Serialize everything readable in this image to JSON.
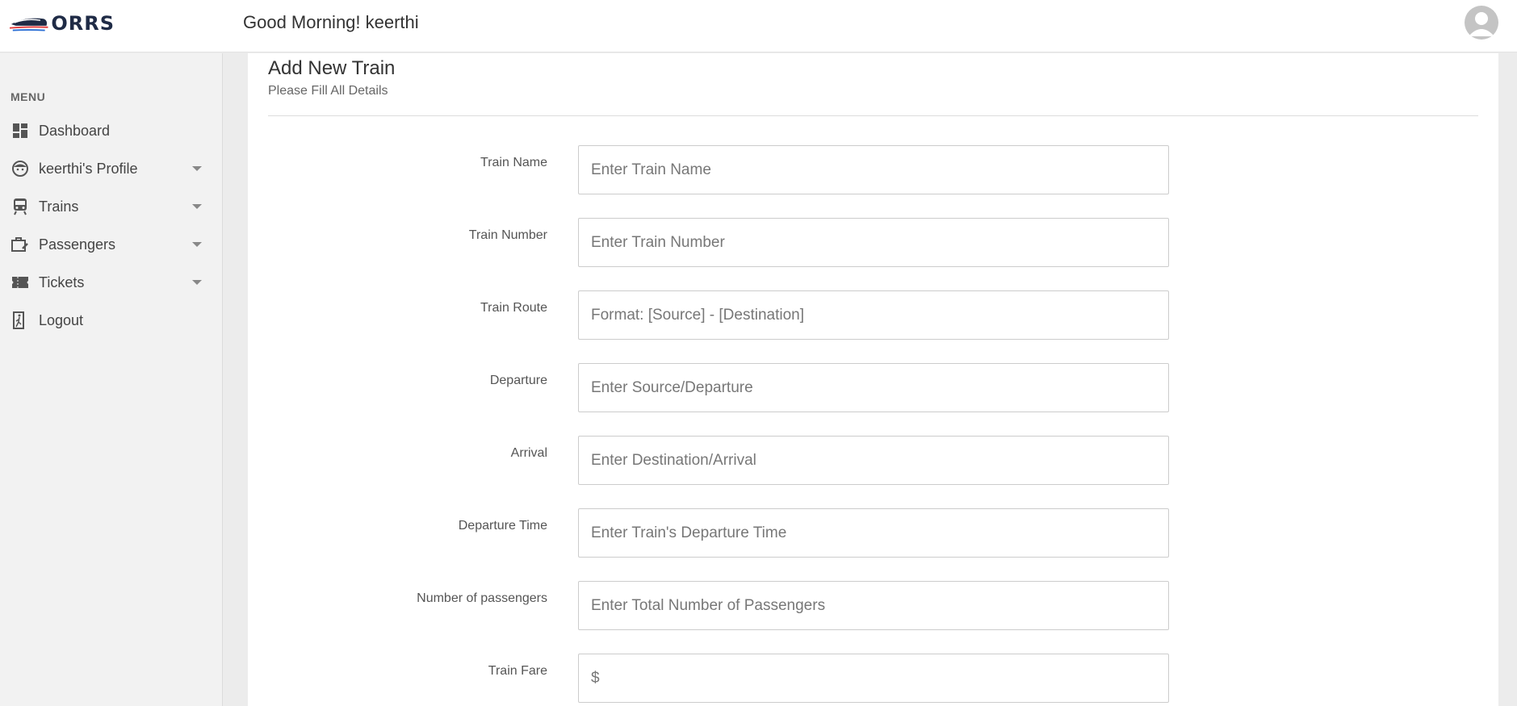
{
  "header": {
    "logo_text": "ORRS",
    "greeting": "Good Morning! keerthi"
  },
  "sidebar": {
    "menu_heading": "MENU",
    "items": [
      {
        "label": "Dashboard",
        "icon": "dashboard-icon",
        "has_caret": false
      },
      {
        "label": "keerthi's Profile",
        "icon": "face-icon",
        "has_caret": true
      },
      {
        "label": "Trains",
        "icon": "train-icon",
        "has_caret": true
      },
      {
        "label": "Passengers",
        "icon": "luggage-icon",
        "has_caret": true
      },
      {
        "label": "Tickets",
        "icon": "ticket-icon",
        "has_caret": true
      },
      {
        "label": "Logout",
        "icon": "logout-icon",
        "has_caret": false
      }
    ]
  },
  "form": {
    "title": "Add New Train",
    "subtitle": "Please Fill All Details",
    "fields": [
      {
        "label": "Train Name",
        "placeholder": "Enter Train Name"
      },
      {
        "label": "Train Number",
        "placeholder": "Enter Train Number"
      },
      {
        "label": "Train Route",
        "placeholder": "Format: [Source] - [Destination]"
      },
      {
        "label": "Departure",
        "placeholder": "Enter Source/Departure"
      },
      {
        "label": "Arrival",
        "placeholder": "Enter Destination/Arrival"
      },
      {
        "label": "Departure Time",
        "placeholder": "Enter Train's Departure Time"
      },
      {
        "label": "Number of passengers",
        "placeholder": "Enter Total Number of Passengers"
      },
      {
        "label": "Train Fare",
        "placeholder": "$"
      }
    ]
  },
  "colors": {
    "logo_dark": "#1f2b46",
    "logo_red": "#e23b3b",
    "logo_blue": "#2a6fd6",
    "sidebar_bg": "#f2f2f2",
    "page_bg": "#ececec"
  }
}
